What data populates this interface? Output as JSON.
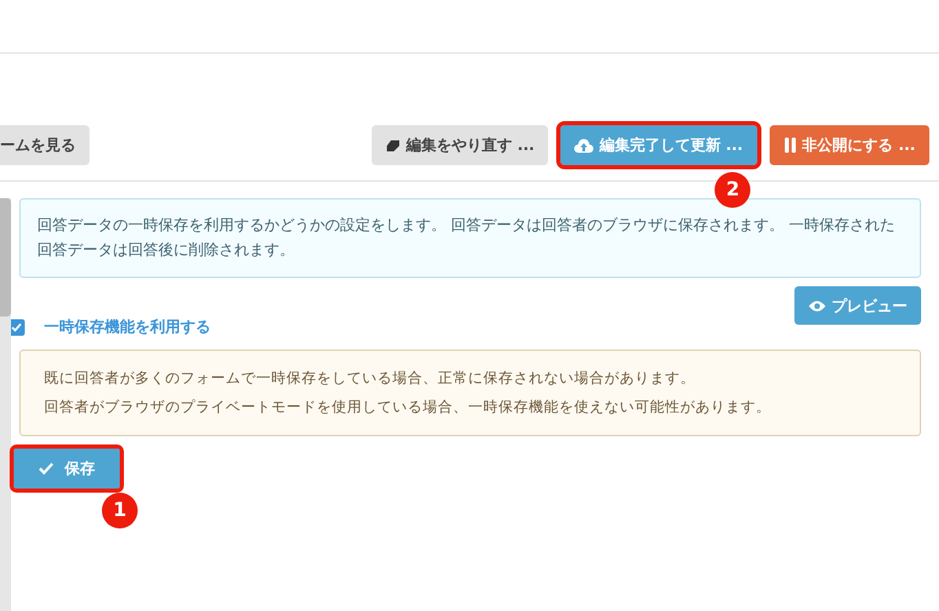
{
  "toolbar": {
    "buttons": [
      {
        "label": "ームを見る",
        "kind": "plain",
        "highlighted": false
      },
      {
        "label": "編集をやり直す ...",
        "kind": "plain",
        "highlighted": false
      },
      {
        "label": "編集完了して更新 ...",
        "kind": "primary",
        "highlighted": true,
        "callout": "2"
      },
      {
        "label": "非公開にする ...",
        "kind": "danger",
        "highlighted": false
      }
    ]
  },
  "info_text": "回答データの一時保存を利用するかどうかの設定をします。 回答データは回答者のブラウザに保存されます。 一時保存された回答データは回答後に削除されます。",
  "preview_button": {
    "label": "プレビュー"
  },
  "option": {
    "label": "一時保存機能を利用する",
    "checked": true
  },
  "warnings": [
    "既に回答者が多くのフォームで一時保存をしている場合、正常に保存されない場合があります。",
    "回答者がブラウザのプライベートモードを使用している場合、一時保存機能を使えない可能性があります。"
  ],
  "save_button": {
    "label": "保存",
    "highlighted": true,
    "callout": "1"
  }
}
